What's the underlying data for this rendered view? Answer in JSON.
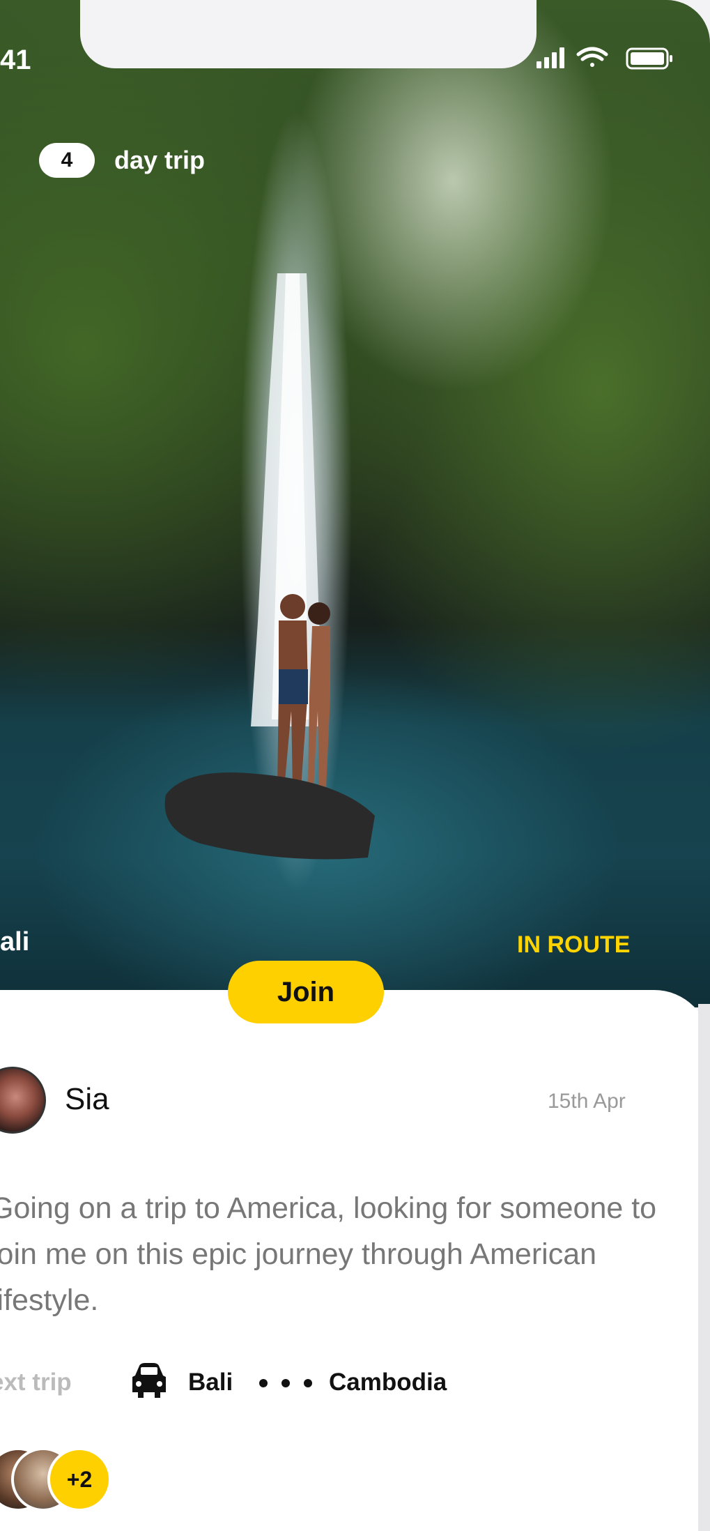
{
  "status_bar": {
    "time": "41",
    "icons": [
      "signal-icon",
      "wifi-icon",
      "battery-icon"
    ]
  },
  "trip": {
    "days": "4",
    "label": "day trip"
  },
  "hero": {
    "location": "ali",
    "status": "IN ROUTE",
    "status_color": "#ffd400"
  },
  "join_label": "Join",
  "post": {
    "author": "Sia",
    "date": "15th Apr",
    "description": "Going on a trip to America, looking for someone to join me on this epic journey through American lifestyle."
  },
  "next_trip": {
    "label": "ext trip",
    "from": "Bali",
    "to": "Cambodia",
    "transport_icon": "car-icon"
  },
  "members": {
    "more_count": "+2"
  },
  "colors": {
    "accent": "#ffd000",
    "card_bg": "#ffffff"
  }
}
